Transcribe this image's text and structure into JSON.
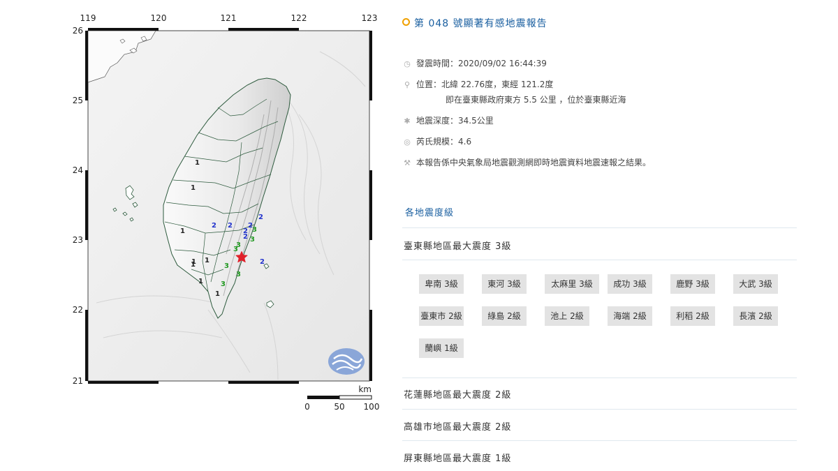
{
  "map": {
    "lon_ticks": [
      "119",
      "120",
      "121",
      "122",
      "123"
    ],
    "lat_ticks": [
      "26",
      "25",
      "24",
      "23",
      "22",
      "21"
    ],
    "scale": {
      "unit": "km",
      "labels": [
        "0",
        "50",
        "100"
      ]
    },
    "epicenter_marker": "red-star",
    "agency_logo": "cwb-logo",
    "intensity_markers": [
      {
        "v": "1",
        "c": "#222"
      },
      {
        "v": "1",
        "c": "#222"
      },
      {
        "v": "1",
        "c": "#222"
      },
      {
        "v": "1",
        "c": "#222"
      },
      {
        "v": "1",
        "c": "#222"
      },
      {
        "v": "1",
        "c": "#222"
      },
      {
        "v": "1",
        "c": "#222"
      },
      {
        "v": "1",
        "c": "#222"
      },
      {
        "v": "2",
        "c": "#2233cc"
      },
      {
        "v": "2",
        "c": "#2233cc"
      },
      {
        "v": "2",
        "c": "#2233cc"
      },
      {
        "v": "2",
        "c": "#2233cc"
      },
      {
        "v": "2",
        "c": "#2233cc"
      },
      {
        "v": "2",
        "c": "#2233cc"
      },
      {
        "v": "2",
        "c": "#2233cc"
      },
      {
        "v": "3",
        "c": "#229922"
      },
      {
        "v": "3",
        "c": "#229922"
      },
      {
        "v": "3",
        "c": "#229922"
      },
      {
        "v": "3",
        "c": "#229922"
      },
      {
        "v": "3",
        "c": "#229922"
      },
      {
        "v": "3",
        "c": "#229922"
      },
      {
        "v": "3",
        "c": "#229922"
      }
    ]
  },
  "report": {
    "title": "第 048 號顯著有感地震報告",
    "time": "發震時間：2020/09/02 16:44:39",
    "location": "位置：北緯 22.76度，東經 121.2度",
    "location_detail": "即在臺東縣政府東方 5.5 公里 ，位於臺東縣近海",
    "depth": "地震深度：34.5公里",
    "magnitude": "芮氏規模：4.6",
    "note": "本報告係中央氣象局地震觀測網即時地震資料地震速報之結果。",
    "section_heading": "各地震度級",
    "counties": [
      "臺東縣地區最大震度 3級",
      "花蓮縣地區最大震度 2級",
      "高雄市地區最大震度 2級",
      "屏東縣地區最大震度 1級"
    ],
    "towns": [
      "卑南 3級",
      "東河 3級",
      "太麻里 3級",
      "成功 3級",
      "鹿野 3級",
      "大武 3級",
      "臺東市 2級",
      "綠島 2級",
      "池上 2級",
      "海端 2級",
      "利稻 2級",
      "長濱 2級",
      "蘭嶼 1級"
    ],
    "icons": [
      "clock-icon",
      "pin-icon",
      "depth-icon",
      "magnitude-icon",
      "wrench-icon"
    ]
  }
}
